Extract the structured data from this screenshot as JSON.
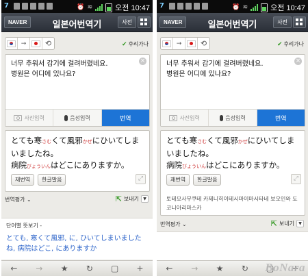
{
  "status": {
    "left_number": "7",
    "time": "오전 10:47"
  },
  "app": {
    "naver_label": "NAVER",
    "title": "일본어번역기",
    "dict_label": "사전"
  },
  "lang": {
    "swap_arrow": "→",
    "furigana_label": "후리가나"
  },
  "input": {
    "line1": "너무 추워서 감기에 걸려버렸네요.",
    "line2": "병원은 어디에 있나요?",
    "clear_label": "×",
    "photo_label": "사진입력",
    "voice_label": "음성입력",
    "translate_label": "번역"
  },
  "result": {
    "s1": "とても寒",
    "r1": "さむ",
    "s2": "くて風邪",
    "r2": "かぜ",
    "s3": "にひいてしまいましたね。",
    "s4": "病院",
    "r4": "びょういん",
    "s5": "はどこにありますか。",
    "retranslate_label": "재번역",
    "pronounce_label": "한글발음",
    "romaji": "토테모사무쿠테 카제니히이테시마이마시타네 보오인와 도코니아리마스카"
  },
  "footer": {
    "eval_label": "번역평가",
    "send_label": "보내기"
  },
  "vocab": {
    "header": "단어별 뜻보기 -",
    "text": "とても, 寒くて風邪, に, ひいてしまいましたね, 病院はどこ, にありますか"
  },
  "toolbar": {
    "back": "←",
    "forward": "→",
    "star": "★",
    "refresh": "↻",
    "tabs": "▢",
    "add": "+"
  },
  "watermark": "BoNara",
  "colors": {
    "translate_blue": "#1d74d6",
    "reading_red": "#d04040",
    "vocab_blue": "#2a62c9"
  }
}
